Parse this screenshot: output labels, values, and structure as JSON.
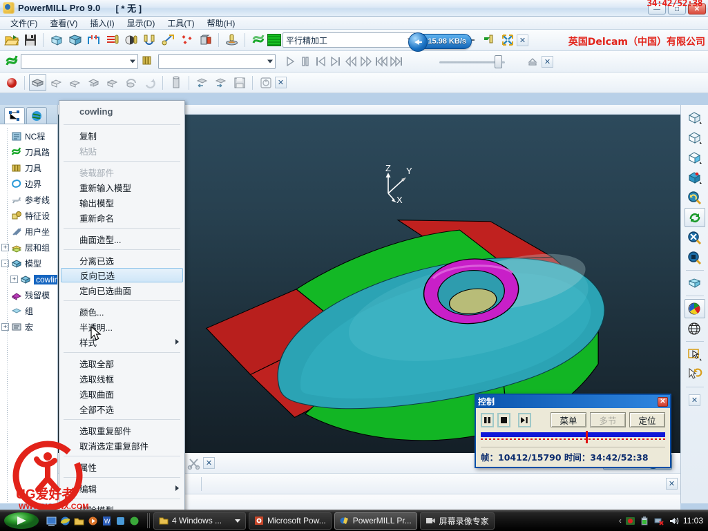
{
  "titlebar": {
    "app_title": "PowerMILL Pro 9.0",
    "document": "[ * 无 ]",
    "icon": "powermill-icon",
    "rec_timestamp": "34:42/52:38",
    "minimize": "—",
    "maximize": "□",
    "close": "✕"
  },
  "menubar": {
    "items": [
      {
        "label": "文件(F)"
      },
      {
        "label": "查看(V)"
      },
      {
        "label": "插入(I)"
      },
      {
        "label": "显示(D)"
      },
      {
        "label": "工具(T)"
      },
      {
        "label": "帮助(H)"
      }
    ]
  },
  "main_toolbar": {
    "strategy_combo_value": "平行精加工",
    "network_speed": "15.98 KB/s",
    "company_banner": "英国Delcam（中国）有限公司",
    "icons": [
      "open-project-icon",
      "save-project-icon",
      "block-icon",
      "model-icon",
      "boundary-icon",
      "toolpath-strategy-icon",
      "tool-icon",
      "feeds-speeds-icon",
      "leads-links-icon",
      "point-distribution-icon",
      "stock-model-icon",
      "simulate-icon",
      "toolpath-list-icon",
      "strategy-selector-icon",
      "viewmill-icon",
      "fit-view-icon",
      "close-toolbar-icon"
    ]
  },
  "sim_toolbar": {
    "toolpath_combo_value": "",
    "tool_combo_value": "",
    "slider_value": "100",
    "buttons": [
      "play",
      "pause",
      "step-back",
      "step-forward",
      "fast-back",
      "fast-forward",
      "to-start",
      "to-end"
    ]
  },
  "viewmill_toolbar": {
    "icons": [
      "viewmill-toggle",
      "shaded-view",
      "no-shading",
      "rainbow-shading",
      "flat-shading",
      "material-shading",
      "rotate-shading",
      "reset-shading",
      "block-material",
      "save-image",
      "compare-model",
      "info",
      "close"
    ]
  },
  "explorer": {
    "tabs": [
      {
        "label": "explorer-tab"
      },
      {
        "label": "world-tab"
      }
    ],
    "tree": [
      {
        "label": "NC程",
        "icon": "nc-program-icon",
        "expander": ""
      },
      {
        "label": "刀具路",
        "icon": "toolpath-icon",
        "expander": ""
      },
      {
        "label": "刀具",
        "icon": "tool-icon",
        "expander": ""
      },
      {
        "label": "边界",
        "icon": "boundary-icon",
        "expander": ""
      },
      {
        "label": "参考线",
        "icon": "pattern-icon",
        "expander": ""
      },
      {
        "label": "特征设",
        "icon": "feature-icon",
        "expander": ""
      },
      {
        "label": "用户坐",
        "icon": "workplane-icon",
        "expander": ""
      },
      {
        "label": "层和组",
        "icon": "level-icon",
        "expander": "+"
      },
      {
        "label": "模型",
        "icon": "model-icon",
        "expander": "-"
      },
      {
        "label": "cowling",
        "icon": "model-item-icon",
        "expander": "+",
        "selected": true
      },
      {
        "label": "残留模",
        "icon": "stock-model-icon",
        "expander": ""
      },
      {
        "label": "组",
        "icon": "group-icon",
        "expander": ""
      },
      {
        "label": "宏",
        "icon": "macro-icon",
        "expander": "+"
      }
    ]
  },
  "context_menu": {
    "header": "cowling",
    "items": [
      {
        "label": "复制",
        "state": "normal"
      },
      {
        "label": "粘贴",
        "state": "disabled"
      },
      {
        "sep": true
      },
      {
        "label": "装载部件",
        "state": "disabled"
      },
      {
        "label": "重新输入模型",
        "state": "normal"
      },
      {
        "label": "输出模型",
        "state": "normal"
      },
      {
        "label": "重新命名",
        "state": "normal"
      },
      {
        "sep": true
      },
      {
        "label": "曲面造型...",
        "state": "normal"
      },
      {
        "sep": true
      },
      {
        "label": "分离已选",
        "state": "normal"
      },
      {
        "label": "反向已选",
        "state": "selected"
      },
      {
        "label": "定向已选曲面",
        "state": "normal"
      },
      {
        "sep": true
      },
      {
        "label": "颜色...",
        "state": "normal"
      },
      {
        "label": "半透明...",
        "state": "normal"
      },
      {
        "label": "样式",
        "state": "normal",
        "submenu": true
      },
      {
        "sep": true
      },
      {
        "label": "选取全部",
        "state": "normal"
      },
      {
        "label": "选取线框",
        "state": "normal"
      },
      {
        "label": "选取曲面",
        "state": "normal"
      },
      {
        "label": "全部不选",
        "state": "normal"
      },
      {
        "sep": true
      },
      {
        "label": "选取重复部件",
        "state": "normal"
      },
      {
        "label": "取消选定重复部件",
        "state": "normal"
      },
      {
        "sep": true
      },
      {
        "label": "属性",
        "state": "normal"
      },
      {
        "sep": true
      },
      {
        "label": "编辑",
        "state": "normal",
        "submenu": true
      },
      {
        "sep": true
      },
      {
        "label": "删除模型",
        "state": "normal"
      }
    ]
  },
  "viewport": {
    "axis_top": {
      "x": "X",
      "y": "Y",
      "z": "Z"
    },
    "axis_bottom": {
      "x": "X",
      "y": "Y",
      "z": "Z"
    },
    "model_name": "cowling",
    "colors": {
      "background_top": "#2d4a5c",
      "background_bottom": "#141f27",
      "red_face": "#c0211f",
      "green_face": "#12b524",
      "teal_body": "#2aa3b4",
      "magenta_ring": "#c81fc8",
      "olive_pocket": "#b8bc78"
    }
  },
  "right_toolbar": {
    "icons": [
      "iso1-view-icon",
      "iso2-view-icon",
      "iso3-view-icon",
      "iso4-view-icon",
      "zoom-previous-icon",
      "refresh-view-icon",
      "zoom-fit-icon",
      "zoom-box-icon",
      "shaded-view-icon",
      "color-shaded-icon",
      "wireframe-globe-icon",
      "select-box-icon",
      "undo-select-icon",
      "close-icon"
    ]
  },
  "control_panel": {
    "title": "控制",
    "close": "✕",
    "transport": [
      "pause-button",
      "stop-button",
      "fast-forward-button"
    ],
    "buttons": [
      {
        "label": "菜单",
        "state": "normal"
      },
      {
        "label": "多节",
        "state": "disabled"
      },
      {
        "label": "定位",
        "state": "normal"
      }
    ],
    "status": "帧：10412/15790 时间：34:42/52:38",
    "progress_percent": 57
  },
  "brand": {
    "delcam_label": "Delcam"
  },
  "watermark": {
    "line1": "UG爱好者",
    "line2": "WWW.UGSNX.COM"
  },
  "taskbar": {
    "start_label": "start",
    "buttons": [
      {
        "label": "4 Windows ...",
        "icon": "folder-group-icon",
        "active": false,
        "dropdown": true
      },
      {
        "label": "Microsoft Pow...",
        "icon": "powerpoint-icon",
        "active": false
      },
      {
        "label": "PowerMILL Pr...",
        "icon": "powermill-icon",
        "active": true
      },
      {
        "label": "屏幕录像专家",
        "icon": "recorder-icon",
        "active": false
      }
    ],
    "tray_icons": [
      "show-hidden-icon",
      "recording-icon",
      "battery-icon",
      "network-disconnected-icon",
      "volume-icon"
    ],
    "clock": "11:03"
  }
}
